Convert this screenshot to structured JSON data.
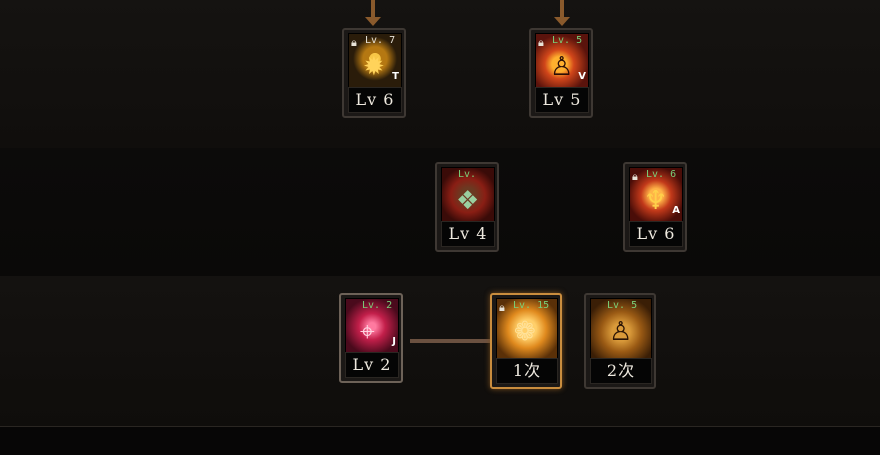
{
  "row1": [
    {
      "level_tag": "Lv. 7",
      "letter": "T",
      "label": "Lv 6",
      "icon": "sun-rune-icon"
    },
    {
      "level_tag": "Lv. 5",
      "letter": "V",
      "label": "Lv 5",
      "icon": "flame-figure-icon"
    }
  ],
  "row2": [
    {
      "level_tag": "Lv.",
      "letter": "",
      "label": "Lv 4",
      "icon": "diamond-laurel-icon"
    },
    {
      "level_tag": "Lv. 6",
      "letter": "A",
      "label": "Lv 6",
      "icon": "phoenix-wings-icon"
    }
  ],
  "row3": [
    {
      "level_tag": "Lv. 2",
      "letter": "J",
      "label": "Lv 2",
      "icon": "crosshair-icon"
    },
    {
      "level_tag": "Lv. 15",
      "letter": "",
      "label": "1次",
      "icon": "rose-icon"
    },
    {
      "level_tag": "Lv. 5",
      "letter": "",
      "label": "2次",
      "icon": "flame-figure-icon"
    }
  ],
  "colors": {
    "gold_border": "#c98d3e",
    "green_level": "#7ad07a"
  }
}
